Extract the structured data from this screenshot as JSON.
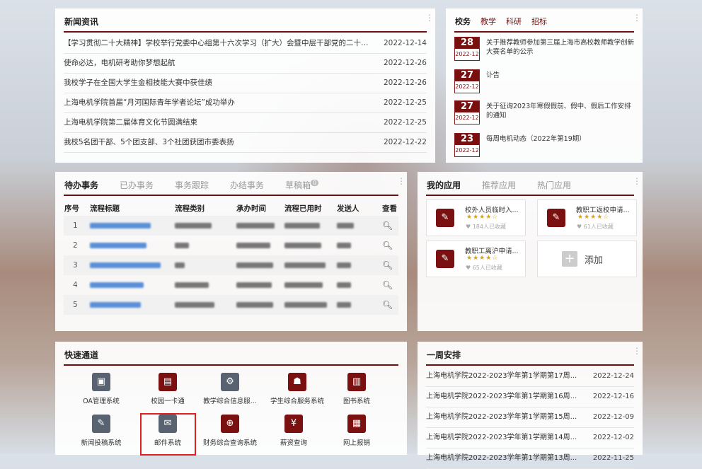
{
  "news": {
    "title": "新闻资讯",
    "items": [
      {
        "title": "【学习贯彻二十大精神】学校举行党委中心组第十六次学习（扩大）会暨中层干部党的二十大...",
        "date": "2022-12-14"
      },
      {
        "title": "使命必达，电机研考助你梦想起航",
        "date": "2022-12-26"
      },
      {
        "title": "我校学子在全国大学生金相技能大赛中获佳绩",
        "date": "2022-12-26"
      },
      {
        "title": "上海电机学院首届“月河国际青年学者论坛”成功举办",
        "date": "2022-12-25"
      },
      {
        "title": "上海电机学院第二届体育文化节圆满结束",
        "date": "2022-12-25"
      },
      {
        "title": "我校5名团干部、5个团支部、3个社团获团市委表扬",
        "date": "2022-12-22"
      }
    ]
  },
  "notices": {
    "tabs": [
      "校务",
      "教学",
      "科研",
      "招标"
    ],
    "items": [
      {
        "day": "28",
        "ym": "2022-12",
        "text": "关于推荐教师参加第三届上海市高校教师教学创新大赛名单的公示"
      },
      {
        "day": "27",
        "ym": "2022-12",
        "text": "讣告"
      },
      {
        "day": "27",
        "ym": "2022-12",
        "text": "关于征询2023年寒假假前、假中、假后工作安排的通知"
      },
      {
        "day": "23",
        "ym": "2022-12",
        "text": "每周电机动态（2022年第19期）"
      }
    ]
  },
  "tasks": {
    "tabs": [
      "待办事务",
      "已办事务",
      "事务跟踪",
      "办结事务",
      "草稿箱"
    ],
    "draft_badge": "0",
    "columns": [
      "序号",
      "流程标题",
      "流程类别",
      "承办时间",
      "流程已用时",
      "发送人",
      "查看"
    ],
    "rows": [
      {
        "no": "1"
      },
      {
        "no": "2"
      },
      {
        "no": "3"
      },
      {
        "no": "4"
      },
      {
        "no": "5"
      }
    ]
  },
  "apps": {
    "tabs": [
      "我的应用",
      "推荐应用",
      "热门应用"
    ],
    "cards": [
      {
        "name": "校外人员临时入...",
        "stars": "★★★★☆",
        "fav": "184人已收藏"
      },
      {
        "name": "教职工返校申请...",
        "stars": "★★★★☆",
        "fav": "61人已收藏"
      },
      {
        "name": "教职工离沪申请...",
        "stars": "★★★★☆",
        "fav": "65人已收藏"
      }
    ],
    "add_label": "添加"
  },
  "quick": {
    "title": "快速通道",
    "items": [
      {
        "label": "OA管理系统",
        "icon": "oa-icon",
        "color": "gray"
      },
      {
        "label": "校园一卡通",
        "icon": "card-icon",
        "color": "red"
      },
      {
        "label": "教学综合信息服...",
        "icon": "teaching-icon",
        "color": "gray"
      },
      {
        "label": "学生综合服务系统",
        "icon": "student-icon",
        "color": "red"
      },
      {
        "label": "图书系统",
        "icon": "book-icon",
        "color": "red"
      },
      {
        "label": "新闻投稿系统",
        "icon": "edit-icon",
        "color": "gray"
      },
      {
        "label": "邮件系统",
        "icon": "mail-icon",
        "color": "gray"
      },
      {
        "label": "财务综合查询系统",
        "icon": "finance-search-icon",
        "color": "red"
      },
      {
        "label": "薪资查询",
        "icon": "salary-icon",
        "color": "red"
      },
      {
        "label": "网上报销",
        "icon": "reimburse-icon",
        "color": "red"
      }
    ]
  },
  "week": {
    "title": "一周安排",
    "items": [
      {
        "title": "上海电机学院2022-2023学年第1学期第17周...",
        "date": "2022-12-24"
      },
      {
        "title": "上海电机学院2022-2023学年第1学期第16周...",
        "date": "2022-12-16"
      },
      {
        "title": "上海电机学院2022-2023学年第1学期第15周...",
        "date": "2022-12-09"
      },
      {
        "title": "上海电机学院2022-2023学年第1学期第14周...",
        "date": "2022-12-02"
      },
      {
        "title": "上海电机学院2022-2023学年第1学期第13周...",
        "date": "2022-11-25"
      }
    ]
  },
  "colors": {
    "accent": "#6e0f0f",
    "highlight": "#e0201e"
  }
}
